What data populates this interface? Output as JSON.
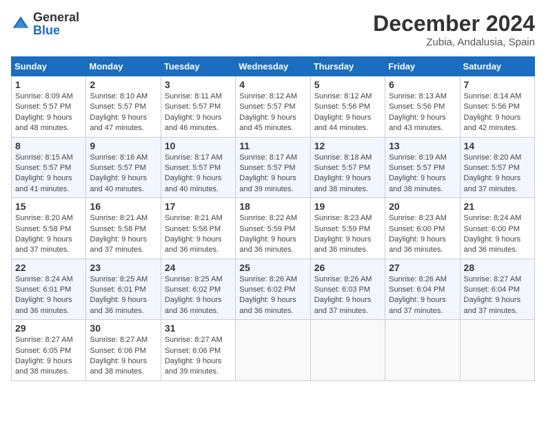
{
  "logo": {
    "general": "General",
    "blue": "Blue"
  },
  "header": {
    "month": "December 2024",
    "location": "Zubia, Andalusia, Spain"
  },
  "weekdays": [
    "Sunday",
    "Monday",
    "Tuesday",
    "Wednesday",
    "Thursday",
    "Friday",
    "Saturday"
  ],
  "weeks": [
    [
      {
        "day": "1",
        "info": "Sunrise: 8:09 AM\nSunset: 5:57 PM\nDaylight: 9 hours and 48 minutes."
      },
      {
        "day": "2",
        "info": "Sunrise: 8:10 AM\nSunset: 5:57 PM\nDaylight: 9 hours and 47 minutes."
      },
      {
        "day": "3",
        "info": "Sunrise: 8:11 AM\nSunset: 5:57 PM\nDaylight: 9 hours and 46 minutes."
      },
      {
        "day": "4",
        "info": "Sunrise: 8:12 AM\nSunset: 5:57 PM\nDaylight: 9 hours and 45 minutes."
      },
      {
        "day": "5",
        "info": "Sunrise: 8:12 AM\nSunset: 5:56 PM\nDaylight: 9 hours and 44 minutes."
      },
      {
        "day": "6",
        "info": "Sunrise: 8:13 AM\nSunset: 5:56 PM\nDaylight: 9 hours and 43 minutes."
      },
      {
        "day": "7",
        "info": "Sunrise: 8:14 AM\nSunset: 5:56 PM\nDaylight: 9 hours and 42 minutes."
      }
    ],
    [
      {
        "day": "8",
        "info": "Sunrise: 8:15 AM\nSunset: 5:57 PM\nDaylight: 9 hours and 41 minutes."
      },
      {
        "day": "9",
        "info": "Sunrise: 8:16 AM\nSunset: 5:57 PM\nDaylight: 9 hours and 40 minutes."
      },
      {
        "day": "10",
        "info": "Sunrise: 8:17 AM\nSunset: 5:57 PM\nDaylight: 9 hours and 40 minutes."
      },
      {
        "day": "11",
        "info": "Sunrise: 8:17 AM\nSunset: 5:57 PM\nDaylight: 9 hours and 39 minutes."
      },
      {
        "day": "12",
        "info": "Sunrise: 8:18 AM\nSunset: 5:57 PM\nDaylight: 9 hours and 38 minutes."
      },
      {
        "day": "13",
        "info": "Sunrise: 8:19 AM\nSunset: 5:57 PM\nDaylight: 9 hours and 38 minutes."
      },
      {
        "day": "14",
        "info": "Sunrise: 8:20 AM\nSunset: 5:57 PM\nDaylight: 9 hours and 37 minutes."
      }
    ],
    [
      {
        "day": "15",
        "info": "Sunrise: 8:20 AM\nSunset: 5:58 PM\nDaylight: 9 hours and 37 minutes."
      },
      {
        "day": "16",
        "info": "Sunrise: 8:21 AM\nSunset: 5:58 PM\nDaylight: 9 hours and 37 minutes."
      },
      {
        "day": "17",
        "info": "Sunrise: 8:21 AM\nSunset: 5:58 PM\nDaylight: 9 hours and 36 minutes."
      },
      {
        "day": "18",
        "info": "Sunrise: 8:22 AM\nSunset: 5:59 PM\nDaylight: 9 hours and 36 minutes."
      },
      {
        "day": "19",
        "info": "Sunrise: 8:23 AM\nSunset: 5:59 PM\nDaylight: 9 hours and 36 minutes."
      },
      {
        "day": "20",
        "info": "Sunrise: 8:23 AM\nSunset: 6:00 PM\nDaylight: 9 hours and 36 minutes."
      },
      {
        "day": "21",
        "info": "Sunrise: 8:24 AM\nSunset: 6:00 PM\nDaylight: 9 hours and 36 minutes."
      }
    ],
    [
      {
        "day": "22",
        "info": "Sunrise: 8:24 AM\nSunset: 6:01 PM\nDaylight: 9 hours and 36 minutes."
      },
      {
        "day": "23",
        "info": "Sunrise: 8:25 AM\nSunset: 6:01 PM\nDaylight: 9 hours and 36 minutes."
      },
      {
        "day": "24",
        "info": "Sunrise: 8:25 AM\nSunset: 6:02 PM\nDaylight: 9 hours and 36 minutes."
      },
      {
        "day": "25",
        "info": "Sunrise: 8:26 AM\nSunset: 6:02 PM\nDaylight: 9 hours and 36 minutes."
      },
      {
        "day": "26",
        "info": "Sunrise: 8:26 AM\nSunset: 6:03 PM\nDaylight: 9 hours and 37 minutes."
      },
      {
        "day": "27",
        "info": "Sunrise: 8:26 AM\nSunset: 6:04 PM\nDaylight: 9 hours and 37 minutes."
      },
      {
        "day": "28",
        "info": "Sunrise: 8:27 AM\nSunset: 6:04 PM\nDaylight: 9 hours and 37 minutes."
      }
    ],
    [
      {
        "day": "29",
        "info": "Sunrise: 8:27 AM\nSunset: 6:05 PM\nDaylight: 9 hours and 38 minutes."
      },
      {
        "day": "30",
        "info": "Sunrise: 8:27 AM\nSunset: 6:06 PM\nDaylight: 9 hours and 38 minutes."
      },
      {
        "day": "31",
        "info": "Sunrise: 8:27 AM\nSunset: 6:06 PM\nDaylight: 9 hours and 39 minutes."
      },
      null,
      null,
      null,
      null
    ]
  ]
}
